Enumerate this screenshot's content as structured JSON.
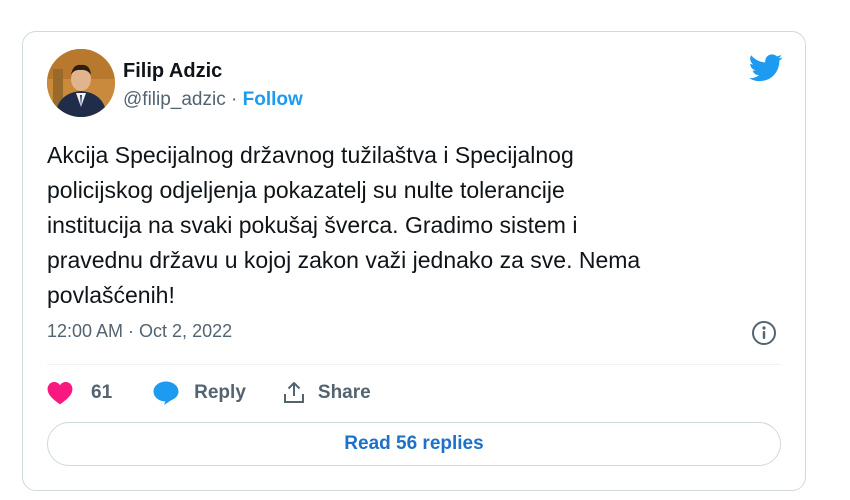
{
  "tweet": {
    "author": {
      "name": "Filip Adzic",
      "handle": "@filip_adzic",
      "separator": " · ",
      "follow_label": "Follow",
      "avatar_icon": "profile-photo"
    },
    "logo_icon": "twitter-bird-icon",
    "text": "Akcija Specijalnog državnog tužilaštva i Specijalnog\npolicijskog odjeljenja pokazatelj su nulte tolerancije\ninstitucija na svaki pokušaj šverca. Gradimo sistem i\npravednu državu u kojoj zakon važi jednako za sve. Nema\npovlašćenih!",
    "timestamp": "12:00 AM · Oct 2, 2022",
    "info_icon": "info-icon",
    "actions": {
      "like_count": "61",
      "reply_label": "Reply",
      "share_label": "Share"
    },
    "read_replies_label": "Read 56 replies"
  },
  "colors": {
    "accent": "#1d9bf0",
    "like": "#f91880",
    "text": "#0f1419",
    "muted": "#536471",
    "border": "#cfd9de"
  }
}
